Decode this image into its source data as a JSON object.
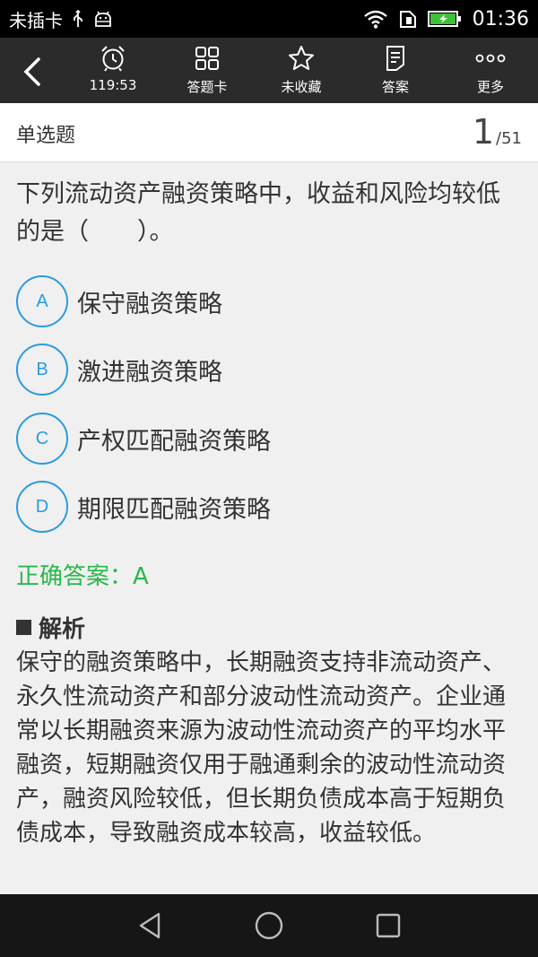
{
  "status_bar": {
    "carrier": "未插卡",
    "time": "01:36"
  },
  "toolbar": {
    "timer": "119:53",
    "answer_card": "答题卡",
    "favorite": "未收藏",
    "answer": "答案",
    "more": "更多"
  },
  "header": {
    "question_type": "单选题",
    "current": "1",
    "total": "/51"
  },
  "question": {
    "text": "下列流动资产融资策略中，收益和风险均较低的是（　　）。",
    "options": [
      {
        "letter": "A",
        "text": "保守融资策略"
      },
      {
        "letter": "B",
        "text": "激进融资策略"
      },
      {
        "letter": "C",
        "text": "产权匹配融资策略"
      },
      {
        "letter": "D",
        "text": "期限匹配融资策略"
      }
    ]
  },
  "answer": {
    "text": "正确答案：A"
  },
  "analysis": {
    "title": "解析",
    "text": "保守的融资策略中，长期融资支持非流动资产、永久性流动资产和部分波动性流动资产。企业通常以长期融资来源为波动性流动资产的平均水平融资，短期融资仅用于融通剩余的波动性流动资产，融资风险较低，但长期负债成本高于短期负债成本，导致融资成本较高，收益较低。"
  },
  "colors": {
    "accent": "#2a9be0",
    "correct": "#29b84a",
    "toolbar_bg": "#2b2b2b"
  }
}
